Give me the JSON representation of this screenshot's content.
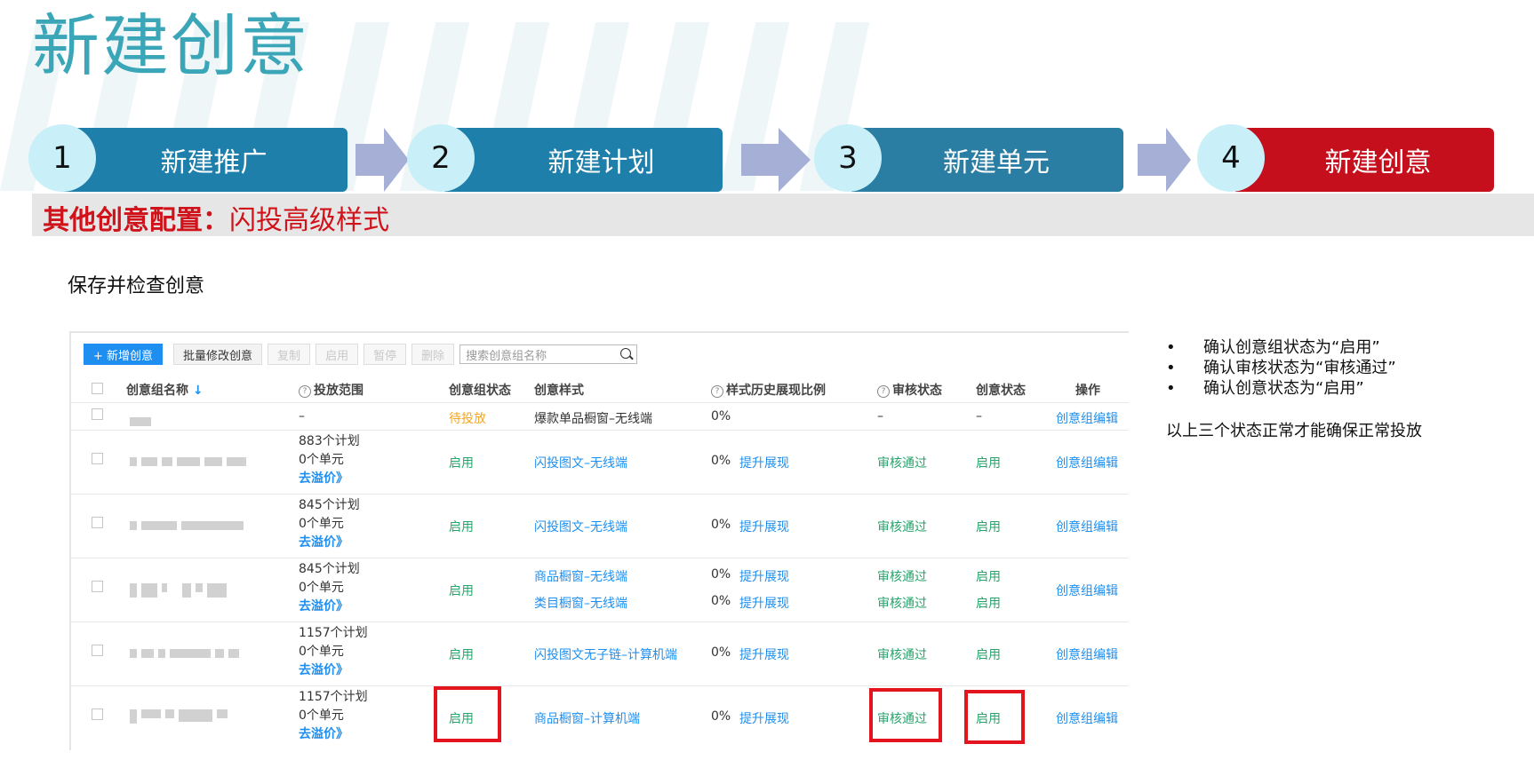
{
  "slide": {
    "title": "新建创意",
    "steps": [
      {
        "num": "1",
        "label": "新建推广"
      },
      {
        "num": "2",
        "label": "新建计划"
      },
      {
        "num": "3",
        "label": "新建单元"
      },
      {
        "num": "4",
        "label": "新建创意"
      }
    ],
    "banner_strong": "其他创意配置：",
    "banner_rest": "闪投高级样式",
    "subtitle": "保存并检查创意",
    "notes": [
      "确认创意组状态为“启用”",
      "确认审核状态为“审核通过”",
      "确认创意状态为“启用”"
    ],
    "summary": "以上三个状态正常才能确保正常投放",
    "colors": {
      "title": "#3aa6b8",
      "step_blue": "#1d7faa",
      "step_active": "#c60f1c",
      "banner_text": "#d0131b",
      "highlight_box": "#e3141d"
    }
  },
  "toolbar": {
    "add_label": "+ 新增创意",
    "batch_label": "批量修改创意",
    "copy_label": "复制",
    "enable_label": "启用",
    "pause_label": "暂停",
    "delete_label": "删除",
    "search_placeholder": "搜索创意组名称"
  },
  "table": {
    "headers": {
      "name": "创意组名称",
      "sort_icon": "arrow-down",
      "scope": "投放范围",
      "group_status": "创意组状态",
      "style": "创意样式",
      "ratio": "样式历史展现比例",
      "review": "审核状态",
      "creative_status": "创意状态",
      "action": "操作"
    },
    "rows": [
      {
        "scope": "–",
        "group_status": "待投放",
        "styles": [
          {
            "style": "爆款单品橱窗–无线端",
            "ratio": "0%",
            "boost": "",
            "review": "–",
            "creative_status": "–"
          }
        ],
        "action": "创意组编辑"
      },
      {
        "plans": "883个计划",
        "units": "0个单元",
        "link": "去溢价》",
        "group_status": "启用",
        "styles": [
          {
            "style": "闪投图文–无线端",
            "ratio": "0%",
            "boost": "提升展现",
            "review": "审核通过",
            "creative_status": "启用"
          }
        ],
        "action": "创意组编辑"
      },
      {
        "plans": "845个计划",
        "units": "0个单元",
        "link": "去溢价》",
        "group_status": "启用",
        "styles": [
          {
            "style": "闪投图文–无线端",
            "ratio": "0%",
            "boost": "提升展现",
            "review": "审核通过",
            "creative_status": "启用"
          }
        ],
        "action": "创意组编辑"
      },
      {
        "plans": "845个计划",
        "units": "0个单元",
        "link": "去溢价》",
        "group_status": "启用",
        "styles": [
          {
            "style": "商品橱窗–无线端",
            "ratio": "0%",
            "boost": "提升展现",
            "review": "审核通过",
            "creative_status": "启用"
          },
          {
            "style": "类目橱窗–无线端",
            "ratio": "0%",
            "boost": "提升展现",
            "review": "审核通过",
            "creative_status": "启用"
          }
        ],
        "action": "创意组编辑"
      },
      {
        "plans": "1157个计划",
        "units": "0个单元",
        "link": "去溢价》",
        "group_status": "启用",
        "styles": [
          {
            "style": "闪投图文无子链–计算机端",
            "ratio": "0%",
            "boost": "提升展现",
            "review": "审核通过",
            "creative_status": "启用"
          }
        ],
        "action": "创意组编辑"
      },
      {
        "plans": "1157个计划",
        "units": "0个单元",
        "link": "去溢价》",
        "group_status": "启用",
        "styles": [
          {
            "style": "商品橱窗–计算机端",
            "ratio": "0%",
            "boost": "提升展现",
            "review": "审核通过",
            "creative_status": "启用"
          }
        ],
        "action": "创意组编辑"
      }
    ]
  }
}
